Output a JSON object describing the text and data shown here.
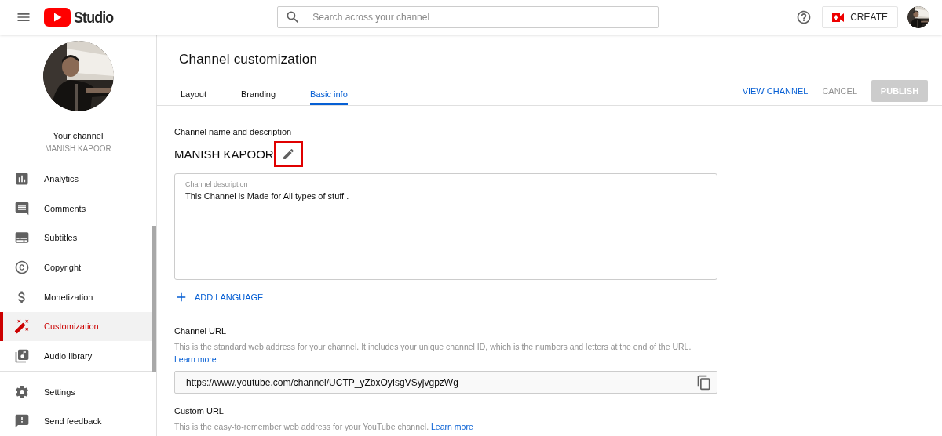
{
  "header": {
    "logo_text": "Studio",
    "search": {
      "placeholder": "Search across your channel"
    },
    "create_button": "CREATE"
  },
  "sidebar": {
    "channel_label": "Your channel",
    "channel_name": "MANISH KAPOOR",
    "items": [
      {
        "label": "Analytics",
        "kind": "analytics",
        "selected": false
      },
      {
        "label": "Comments",
        "kind": "comments",
        "selected": false
      },
      {
        "label": "Subtitles",
        "kind": "subtitles",
        "selected": false
      },
      {
        "label": "Copyright",
        "kind": "copyright",
        "selected": false
      },
      {
        "label": "Monetization",
        "kind": "monetization",
        "selected": false
      },
      {
        "label": "Customization",
        "kind": "customization",
        "selected": true
      },
      {
        "label": "Audio library",
        "kind": "audio",
        "selected": false
      }
    ],
    "footer_items": [
      {
        "label": "Settings",
        "kind": "settings",
        "selected": false
      },
      {
        "label": "Send feedback",
        "kind": "feedback",
        "selected": false
      }
    ]
  },
  "main": {
    "title": "Channel customization",
    "tabs": [
      {
        "label": "Layout",
        "selected": false
      },
      {
        "label": "Branding",
        "selected": false
      },
      {
        "label": "Basic info",
        "selected": true
      }
    ],
    "actions": {
      "view_channel": "VIEW CHANNEL",
      "cancel": "CANCEL",
      "publish": {
        "label": "PUBLISH",
        "disabled": true
      }
    },
    "name_section": {
      "heading": "Channel name and description",
      "channel_name": "MANISH KAPOOR",
      "edit_highlighted": true
    },
    "description_field": {
      "label": "Channel description",
      "value": "This Channel is Made for All types of stuff ."
    },
    "add_language": "ADD LANGUAGE",
    "channel_url": {
      "heading": "Channel URL",
      "description": "This is the standard web address for your channel. It includes your unique channel ID, which is the numbers and letters at the end of the URL.",
      "link": "Learn more",
      "value": "https://www.youtube.com/channel/UCTP_yZbxOyIsgVSyjvgpzWg"
    },
    "custom_url": {
      "heading": "Custom URL",
      "description": "This is the easy-to-remember web address for your YouTube channel.",
      "link": "Learn more"
    }
  }
}
